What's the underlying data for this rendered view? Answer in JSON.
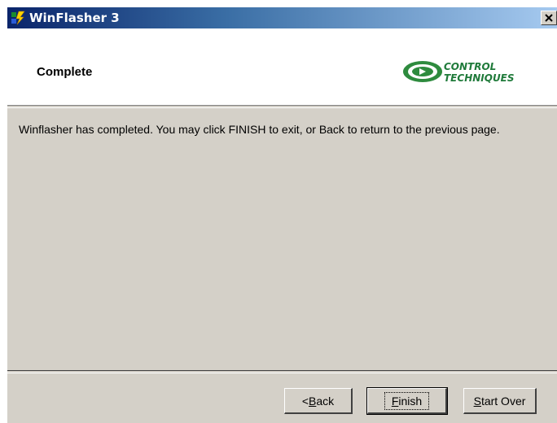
{
  "window": {
    "title": "WinFlasher 3",
    "close_glyph": "✕"
  },
  "header": {
    "title": "Complete",
    "logo": {
      "line1": "CONTROL",
      "line2": "TECHNIQUES",
      "color": "#1f7a3a"
    }
  },
  "main": {
    "message": "Winflasher has completed. You may click FINISH to exit, or Back to return to the previous page."
  },
  "buttons": {
    "back": {
      "prefix": "< ",
      "accel": "B",
      "rest": "ack"
    },
    "finish": {
      "accel": "F",
      "rest": "inish"
    },
    "start_over": {
      "accel": "S",
      "rest": "tart Over"
    }
  }
}
